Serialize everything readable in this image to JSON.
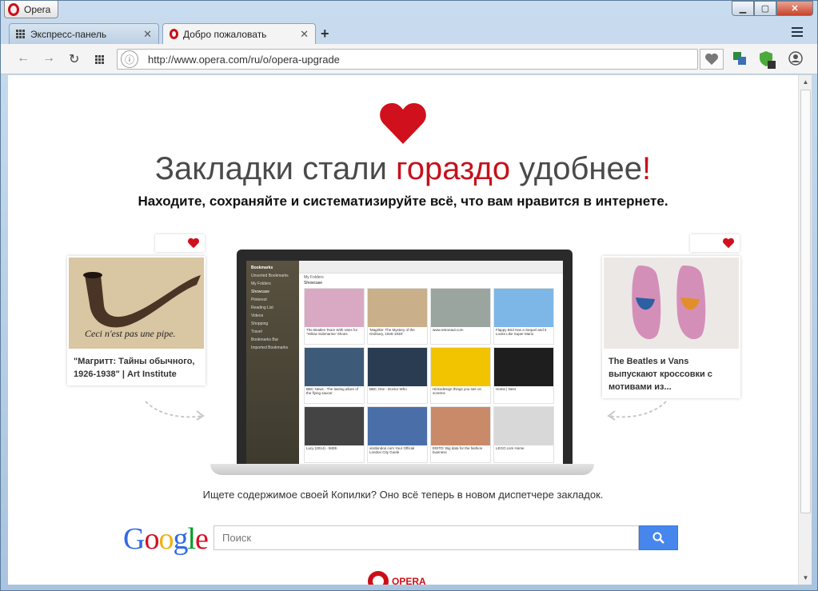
{
  "window": {
    "menu_label": "Opera",
    "controls": {
      "minimize": "▁",
      "maximize": "▢",
      "close": "✕"
    }
  },
  "tabs": [
    {
      "label": "Экспресс-панель",
      "icon": "grid-icon",
      "close": "✕"
    },
    {
      "label": "Добро пожаловать",
      "icon": "opera-icon",
      "close": "✕"
    }
  ],
  "new_tab": "+",
  "toolbar": {
    "back": "←",
    "forward": "→",
    "reload": "↻",
    "url": "http://www.opera.com/ru/o/opera-upgrade",
    "site_icon": "ⓘ"
  },
  "page": {
    "headline_a": "Закладки стали ",
    "headline_red": "гораздо",
    "headline_b": " удобнее",
    "headline_mark": "!",
    "subline": "Находите, сохраняйте и систематизируйте всё, что вам нравится в интернете.",
    "left_card": "\"Магритт: Тайны обычного, 1926-1938\" | Art Institute",
    "left_card_img_text": "Ceci n'est pas une pipe.",
    "right_card": "The Beatles и Vans выпускают кроссовки с мотивами из...",
    "copilka": "Ищете содержимое своей Копилки? Оно всё теперь в новом диспетчере закладок.",
    "search_placeholder": "Поиск",
    "footer_brand": "OPERA"
  },
  "screen": {
    "app_title": "Bookmarks",
    "sidebar": [
      "Unsorted Bookmarks",
      "My Folders",
      "Showcase",
      "Pinterest",
      "Reading List",
      "Videos",
      "Shopping",
      "Travel",
      "Bookmarks Bar",
      "Imported Bookmarks"
    ],
    "breadcrumb": "My Folders",
    "folder": "Showcase",
    "thumbs": [
      {
        "caption": "The Beatles Team With Vans for 'Yellow Submarine' Shoes",
        "color": "#d9a9c4"
      },
      {
        "caption": "'Magritte: The Mystery of the Ordinary, 1926-1938'",
        "color": "#c9b08a"
      },
      {
        "caption": "www.retronaut.com",
        "color": "#9aa5a0"
      },
      {
        "caption": "Flappy Bird Has a Sequel and it Looks Like Super Mario",
        "color": "#7db7e8"
      },
      {
        "caption": "BBC News - The lasting allure of the flying saucer",
        "color": "#3d5a78"
      },
      {
        "caption": "BBC One - Doctor Who",
        "color": "#2a3c52"
      },
      {
        "caption": "Hickodesign things you see on screens",
        "color": "#f2c400"
      },
      {
        "caption": "Home | Nest",
        "color": "#1e1e1e"
      },
      {
        "caption": "Lucy (2014) - IMDb",
        "color": "#444444"
      },
      {
        "caption": "visitlondon.com Your Official London City Guide",
        "color": "#4a6fa8"
      },
      {
        "caption": "EDITD: Big data for the fashion business",
        "color": "#c98a6a"
      },
      {
        "caption": "LEGO.com Home",
        "color": "#d8d8d8"
      }
    ]
  },
  "colors": {
    "accent_red": "#c4121d",
    "google_blue": "#4787ed"
  }
}
